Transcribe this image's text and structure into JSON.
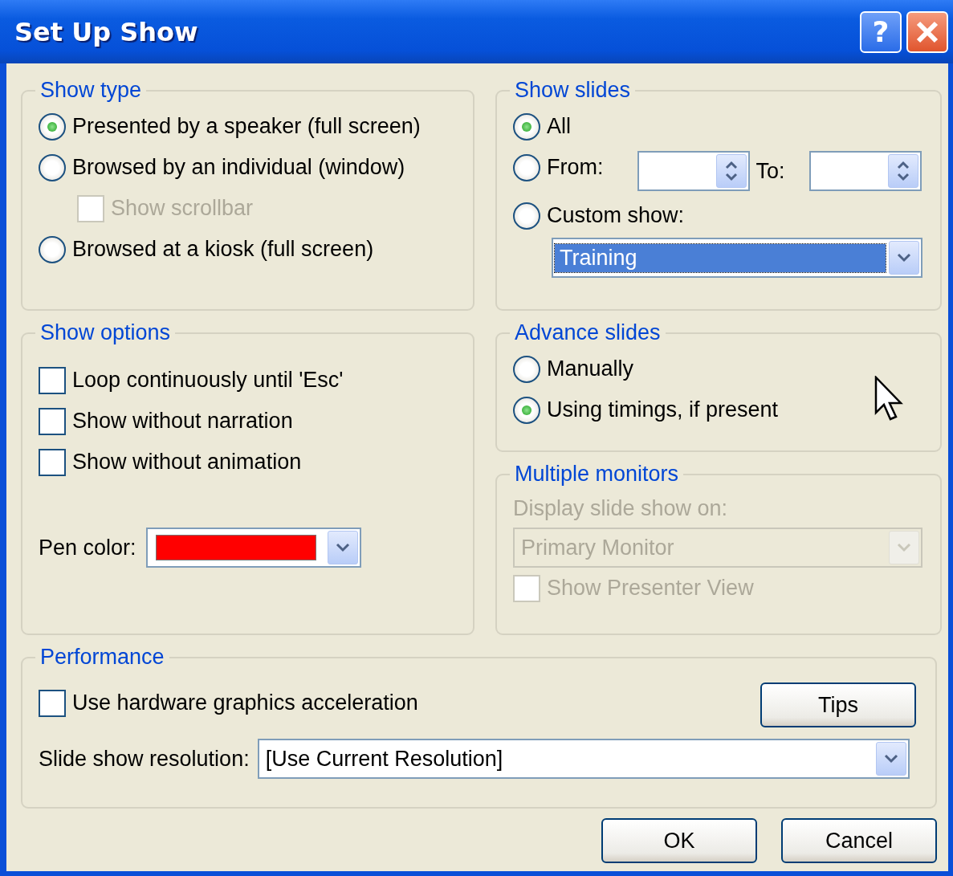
{
  "window": {
    "title": "Set Up Show",
    "help_button": "?"
  },
  "show_type": {
    "title": "Show type",
    "options": [
      {
        "kind": "radio",
        "label": "Presented by a speaker (full screen)",
        "selected": true
      },
      {
        "kind": "radio",
        "label": "Browsed by an individual (window)",
        "selected": false,
        "children": [
          {
            "kind": "checkbox",
            "label": "Show scrollbar",
            "checked": false,
            "disabled": true
          }
        ]
      },
      {
        "kind": "radio",
        "label": "Browsed at a kiosk (full screen)",
        "selected": false
      }
    ]
  },
  "show_options": {
    "title": "Show options",
    "options": [
      {
        "label": "Loop continuously until 'Esc'",
        "checked": false
      },
      {
        "label": "Show without narration",
        "checked": false
      },
      {
        "label": "Show without animation",
        "checked": false
      }
    ],
    "pen_color": {
      "label": "Pen color:",
      "color": "#ff0000"
    }
  },
  "show_slides": {
    "title": "Show slides",
    "options": [
      {
        "kind": "all",
        "label": "All",
        "selected": true
      },
      {
        "kind": "range",
        "label": "From:",
        "selected": false,
        "to_label": "To:"
      },
      {
        "kind": "custom",
        "label": "Custom show:",
        "selected": false
      }
    ],
    "custom_show": {
      "value": "Training",
      "focused": true
    }
  },
  "advance_slides": {
    "title": "Advance slides",
    "options": [
      {
        "label": "Manually",
        "selected": false
      },
      {
        "label": "Using timings, if present",
        "selected": true
      }
    ]
  },
  "multiple_monitors": {
    "title": "Multiple monitors",
    "disabled": true,
    "label": "Display slide show on:",
    "monitor": "Primary Monitor",
    "presenter_view": {
      "label": "Show Presenter View",
      "checked": false
    }
  },
  "performance": {
    "title": "Performance",
    "hardware": {
      "label": "Use hardware graphics acceleration",
      "checked": false
    },
    "tips_button": "Tips",
    "resolution_label": "Slide show resolution:",
    "resolution": "[Use Current Resolution]"
  },
  "buttons": [
    "OK",
    "Cancel"
  ]
}
